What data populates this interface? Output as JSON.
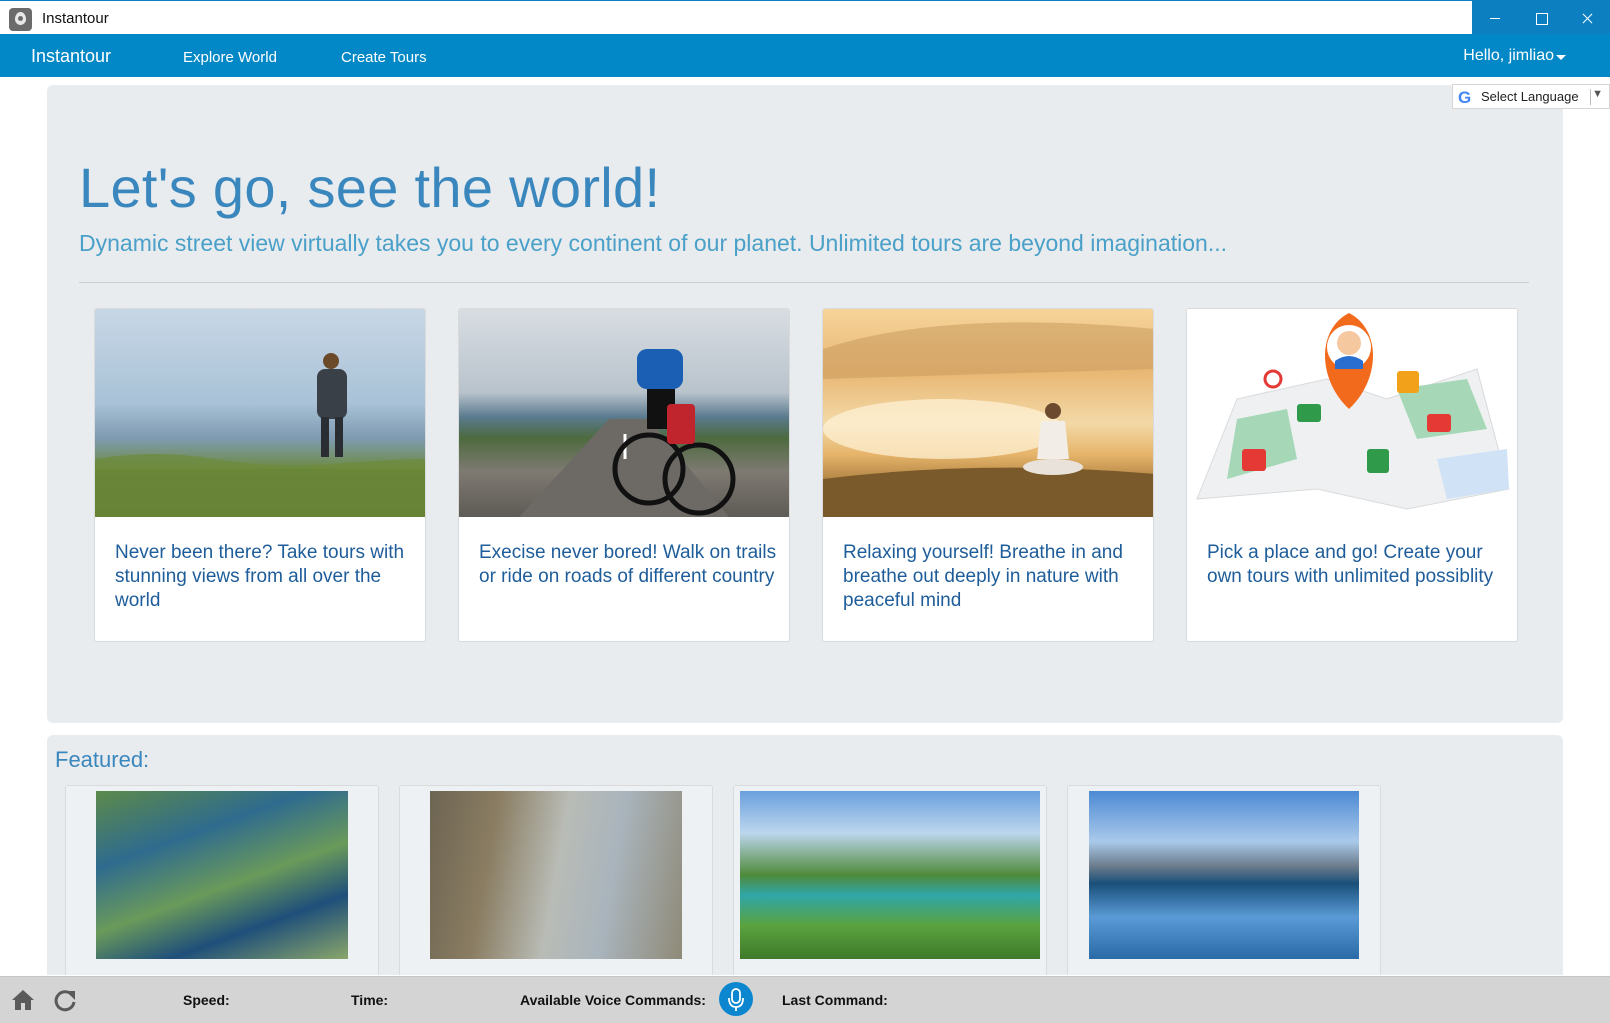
{
  "window": {
    "title": "Instantour",
    "accent": "#0b7fc0"
  },
  "nav": {
    "brand": "Instantour",
    "links": [
      "Explore World",
      "Create Tours"
    ],
    "user": "Hello, jimliao",
    "color": "#0288c6"
  },
  "language": {
    "label": "Select Language"
  },
  "hero": {
    "title": "Let's go, see the world!",
    "subtitle": "Dynamic street view virtually takes you to every continent of our planet. Unlimited tours are beyond imagination...",
    "cards": [
      {
        "caption": "Never been there? Take tours with stunning views from all over the world",
        "image": "hiker-photo"
      },
      {
        "caption": "Execise never bored! Walk on trails or ride on roads of different country",
        "image": "cyclist-photo"
      },
      {
        "caption": "Relaxing yourself! Breathe in and breathe out deeply in nature with peaceful mind",
        "image": "meditation-photo"
      },
      {
        "caption": "Pick a place and go! Create your own tours with unlimited possiblity",
        "image": "map-pin-illustration"
      }
    ]
  },
  "featured": {
    "label": "Featured:",
    "items": [
      "mountain-lakes-photo",
      "cyclists-coastal-road-photo",
      "alpine-valley-lake-photo",
      "snowy-peaks-reflection-photo"
    ]
  },
  "status": {
    "speed_label": "Speed:",
    "time_label": "Time:",
    "voice_label": "Available Voice Commands:",
    "last_label": "Last Command:"
  }
}
